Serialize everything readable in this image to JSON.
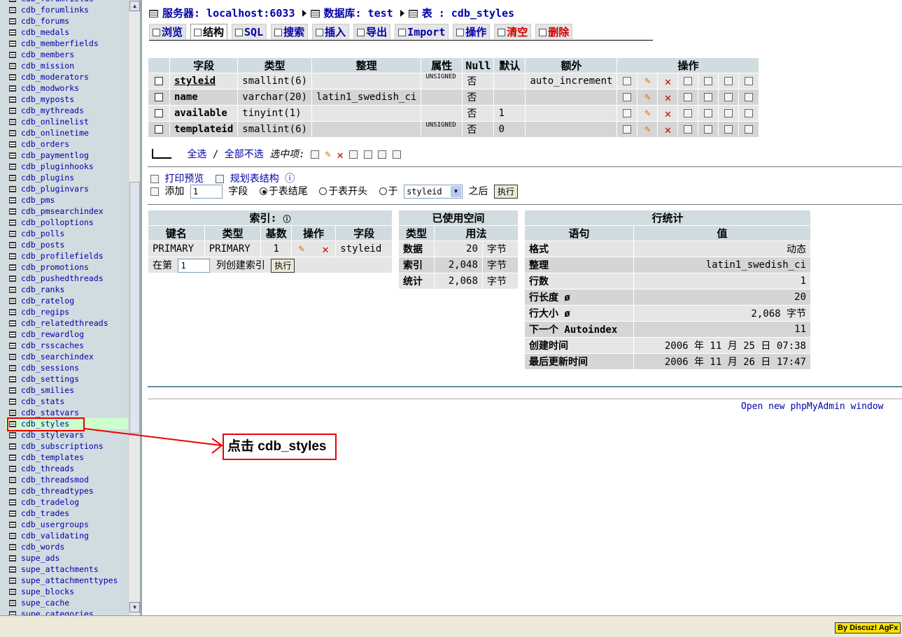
{
  "left_tables": [
    "cdb_forumfields",
    "cdb_forumlinks",
    "cdb_forums",
    "cdb_medals",
    "cdb_memberfields",
    "cdb_members",
    "cdb_mission",
    "cdb_moderators",
    "cdb_modworks",
    "cdb_myposts",
    "cdb_mythreads",
    "cdb_onlinelist",
    "cdb_onlinetime",
    "cdb_orders",
    "cdb_paymentlog",
    "cdb_pluginhooks",
    "cdb_plugins",
    "cdb_pluginvars",
    "cdb_pms",
    "cdb_pmsearchindex",
    "cdb_polloptions",
    "cdb_polls",
    "cdb_posts",
    "cdb_profilefields",
    "cdb_promotions",
    "cdb_pushedthreads",
    "cdb_ranks",
    "cdb_ratelog",
    "cdb_regips",
    "cdb_relatedthreads",
    "cdb_rewardlog",
    "cdb_rsscaches",
    "cdb_searchindex",
    "cdb_sessions",
    "cdb_settings",
    "cdb_smilies",
    "cdb_stats",
    "cdb_statvars",
    "cdb_styles",
    "cdb_stylevars",
    "cdb_subscriptions",
    "cdb_templates",
    "cdb_threads",
    "cdb_threadsmod",
    "cdb_threadtypes",
    "cdb_tradelog",
    "cdb_trades",
    "cdb_usergroups",
    "cdb_validating",
    "cdb_words",
    "supe_ads",
    "supe_attachments",
    "supe_attachmenttypes",
    "supe_blocks",
    "supe_cache",
    "supe_categories"
  ],
  "active_table": "cdb_styles",
  "breadcrumb": {
    "server": "服务器: localhost:6033",
    "database": "数据库: test",
    "table": "表 : cdb_styles"
  },
  "tabs": [
    "浏览",
    "结构",
    "SQL",
    "搜索",
    "插入",
    "导出",
    "Import",
    "操作",
    "清空",
    "删除"
  ],
  "fields_table": {
    "headers": [
      "字段",
      "类型",
      "整理",
      "属性",
      "Null",
      "默认",
      "额外",
      "操作"
    ],
    "rows": [
      {
        "field": "styleid",
        "type": "smallint(6)",
        "collation": "",
        "attr": "UNSIGNED",
        "null": "否",
        "default": "",
        "extra": "auto_increment"
      },
      {
        "field": "name",
        "type": "varchar(20)",
        "collation": "latin1_swedish_ci",
        "attr": "",
        "null": "否",
        "default": "",
        "extra": ""
      },
      {
        "field": "available",
        "type": "tinyint(1)",
        "collation": "",
        "attr": "",
        "null": "否",
        "default": "1",
        "extra": ""
      },
      {
        "field": "templateid",
        "type": "smallint(6)",
        "collation": "",
        "attr": "UNSIGNED",
        "null": "否",
        "default": "0",
        "extra": ""
      }
    ]
  },
  "selection": {
    "select_all": "全选",
    "sep": "/",
    "unselect_all": "全部不选",
    "with_selected": "选中项:"
  },
  "print_row": {
    "print": "打印预览",
    "propose": "规划表结构"
  },
  "add_row": {
    "add": "添加",
    "count": "1",
    "fields": "字段",
    "at_end": "于表结尾",
    "at_begin": "于表开头",
    "after_prefix": "于",
    "after_field": "styleid",
    "after_suffix": "之后",
    "go": "执行"
  },
  "indexes": {
    "title": "索引:",
    "headers": [
      "键名",
      "类型",
      "基数",
      "操作",
      "字段"
    ],
    "rows": [
      {
        "name": "PRIMARY",
        "type": "PRIMARY",
        "card": "1",
        "field": "styleid"
      }
    ],
    "create_prefix": "在第",
    "create_count": "1",
    "create_suffix": "列创建索引",
    "go": "执行"
  },
  "space": {
    "title": "已使用空间",
    "headers": [
      "类型",
      "用法"
    ],
    "rows": [
      {
        "type": "数据",
        "value": "20",
        "unit": "字节"
      },
      {
        "type": "索引",
        "value": "2,048",
        "unit": "字节"
      },
      {
        "type": "统计",
        "value": "2,068",
        "unit": "字节"
      }
    ]
  },
  "row_stats": {
    "title": "行统计",
    "headers": [
      "语句",
      "值"
    ],
    "rows": [
      {
        "k": "格式",
        "v": "动态"
      },
      {
        "k": "整理",
        "v": "latin1_swedish_ci"
      },
      {
        "k": "行数",
        "v": "1"
      },
      {
        "k": "行长度 ø",
        "v": "20"
      },
      {
        "k": "行大小 ø",
        "v": "2,068 字节"
      },
      {
        "k": "下一个 Autoindex",
        "v": "11"
      },
      {
        "k": "创建时间",
        "v": "2006 年 11 月 25 日 07:38"
      },
      {
        "k": "最后更新时间",
        "v": "2006 年 11 月 26 日 17:47"
      }
    ]
  },
  "open_new": "Open new phpMyAdmin window",
  "annotation": "点击 cdb_styles",
  "stamp": "By Discuz! AgFx",
  "colors": {
    "link": "#0000aa",
    "header_bg": "#d0dce0",
    "row_odd": "#e5e5e5",
    "row_even": "#d5d5d5",
    "annotation": "#ee0000",
    "left_bg": "#d0dce0"
  }
}
